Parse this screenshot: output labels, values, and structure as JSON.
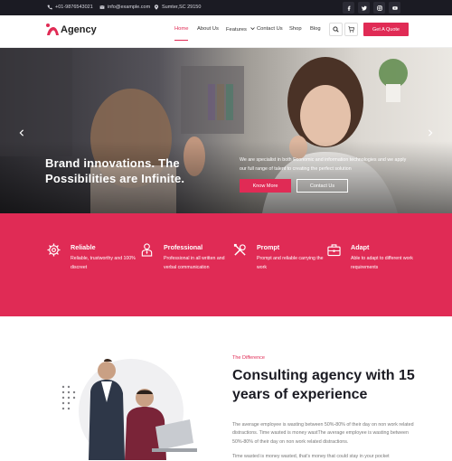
{
  "topbar": {
    "phone": "+01-9876543021",
    "email": "info@example.com",
    "location": "Sumter,SC 29150",
    "social_icons": [
      "facebook-icon",
      "twitter-icon",
      "instagram-icon",
      "youtube-icon"
    ]
  },
  "navbar": {
    "logo_text": "Agency",
    "items": [
      {
        "label": "Home",
        "active": true
      },
      {
        "label": "About Us"
      },
      {
        "label": "Features",
        "has_dropdown": true
      },
      {
        "label": "Contact Us"
      },
      {
        "label": "Shop"
      },
      {
        "label": "Blog"
      }
    ],
    "cta_label": "Get A Quote",
    "accent": "#e02b55"
  },
  "hero": {
    "title": "Brand innovations. The Possibilities are Infinite.",
    "subtitle": "We are specialist in both Economic and information technologies and we apply our full range of talent to creating the perfect solution",
    "primary_button": "Know More",
    "secondary_button": "Contact Us",
    "slides_total": 2,
    "active_slide": 1
  },
  "features": [
    {
      "icon": "gear-icon",
      "title": "Reliable",
      "description": "Reliable, trustworthy and 100% discreet"
    },
    {
      "icon": "professional-person-icon",
      "title": "Professional",
      "description": "Professional in all written and verbal communication"
    },
    {
      "icon": "tools-icon",
      "title": "Prompt",
      "description": "Prompt and reliable carrying the work"
    },
    {
      "icon": "briefcase-icon",
      "title": "Adapt",
      "description": "Able to adapt to different work requirements"
    }
  ],
  "about": {
    "eyebrow": "The Difference",
    "title": "Consulting agency with 15 years of experience",
    "paragraph_1": "The average employee is wasting between 50%-80% of their day on non work related distractions. Time wasted is money wastThe average employee is wasting between 50%-80% of their day on non work related distractions.",
    "paragraph_2": "Time wasted is money wasted, that's money that could stay in your pocket"
  },
  "colors": {
    "accent": "#e02b55",
    "dark": "#1b1b23"
  }
}
